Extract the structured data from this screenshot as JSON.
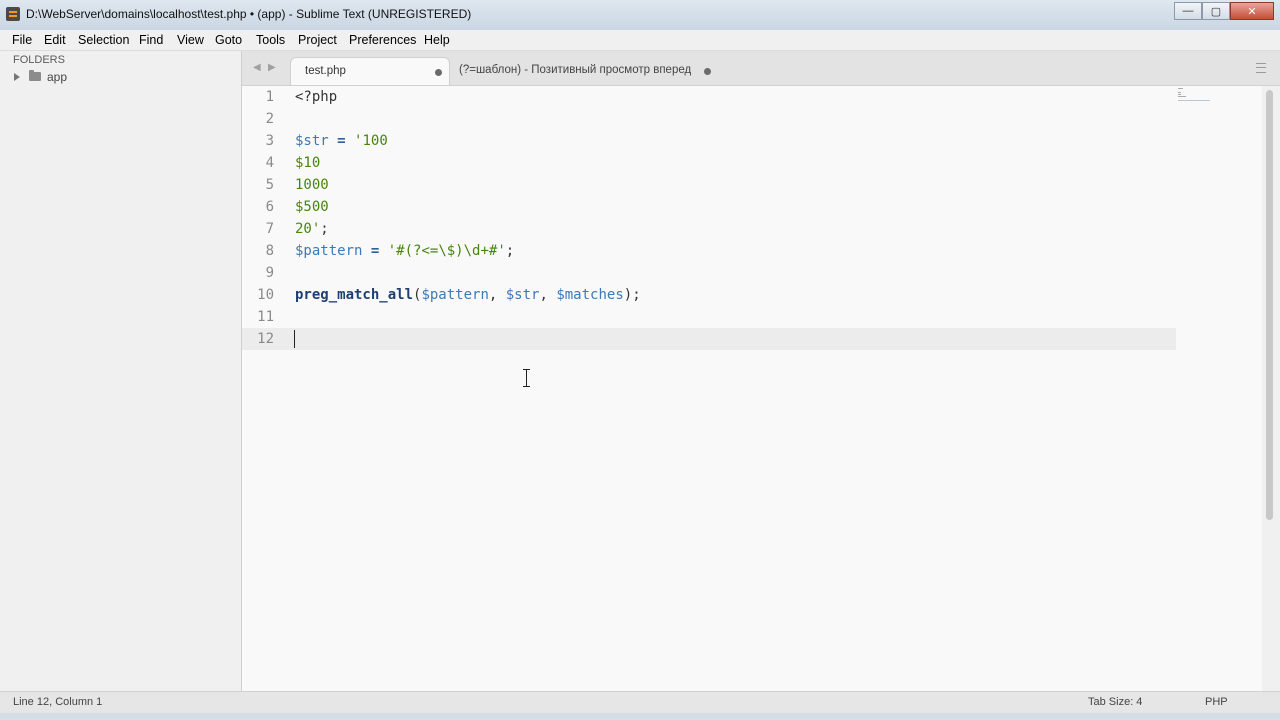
{
  "window": {
    "title": "D:\\WebServer\\domains\\localhost\\test.php • (app) - Sublime Text (UNREGISTERED)",
    "minimize_glyph": "—",
    "maximize_glyph": "▢",
    "close_glyph": "✕"
  },
  "menu": {
    "items": [
      "File",
      "Edit",
      "Selection",
      "Find",
      "View",
      "Goto",
      "Tools",
      "Project",
      "Preferences",
      "Help"
    ]
  },
  "sidebar": {
    "heading": "FOLDERS",
    "items": [
      {
        "label": "app",
        "icon": "folder-icon",
        "expanded": false
      }
    ]
  },
  "tabs": {
    "back_glyph": "◀",
    "forward_glyph": "▶",
    "items": [
      {
        "label": "test.php",
        "active": true,
        "modified": true
      },
      {
        "label": "(?=шаблон) - Позитивный просмотр вперед",
        "active": false,
        "modified": true
      }
    ]
  },
  "editor": {
    "current_line": 12,
    "lines": [
      {
        "num": "1",
        "tokens": [
          {
            "t": "<?php",
            "k": "plain"
          }
        ]
      },
      {
        "num": "2",
        "tokens": []
      },
      {
        "num": "3",
        "tokens": [
          {
            "t": "$str",
            "k": "var"
          },
          {
            "t": " ",
            "k": "plain"
          },
          {
            "t": "=",
            "k": "op"
          },
          {
            "t": " ",
            "k": "plain"
          },
          {
            "t": "'100",
            "k": "str"
          }
        ]
      },
      {
        "num": "4",
        "tokens": [
          {
            "t": "$10",
            "k": "str"
          }
        ]
      },
      {
        "num": "5",
        "tokens": [
          {
            "t": "1000",
            "k": "str"
          }
        ]
      },
      {
        "num": "6",
        "tokens": [
          {
            "t": "$500",
            "k": "str"
          }
        ]
      },
      {
        "num": "7",
        "tokens": [
          {
            "t": "20'",
            "k": "str"
          },
          {
            "t": ";",
            "k": "plain"
          }
        ]
      },
      {
        "num": "8",
        "tokens": [
          {
            "t": "$pattern",
            "k": "var"
          },
          {
            "t": " ",
            "k": "plain"
          },
          {
            "t": "=",
            "k": "op"
          },
          {
            "t": " ",
            "k": "plain"
          },
          {
            "t": "'#(?<=\\$)\\d+#'",
            "k": "str"
          },
          {
            "t": ";",
            "k": "plain"
          }
        ]
      },
      {
        "num": "9",
        "tokens": []
      },
      {
        "num": "10",
        "tokens": [
          {
            "t": "preg_match_all",
            "k": "fn"
          },
          {
            "t": "(",
            "k": "plain"
          },
          {
            "t": "$pattern",
            "k": "var"
          },
          {
            "t": ", ",
            "k": "plain"
          },
          {
            "t": "$str",
            "k": "var"
          },
          {
            "t": ", ",
            "k": "plain"
          },
          {
            "t": "$matches",
            "k": "var"
          },
          {
            "t": ");",
            "k": "plain"
          }
        ]
      },
      {
        "num": "11",
        "tokens": []
      },
      {
        "num": "12",
        "tokens": []
      }
    ]
  },
  "status": {
    "position": "Line 12, Column 1",
    "tab_size": "Tab Size: 4",
    "syntax": "PHP"
  },
  "colors": {
    "variable": "#3a7ab8",
    "operator": "#2f5fa0",
    "string": "#47850c",
    "function": "#1f3f73",
    "editor_bg": "#f9f9f9",
    "current_line_bg": "#ececec"
  }
}
